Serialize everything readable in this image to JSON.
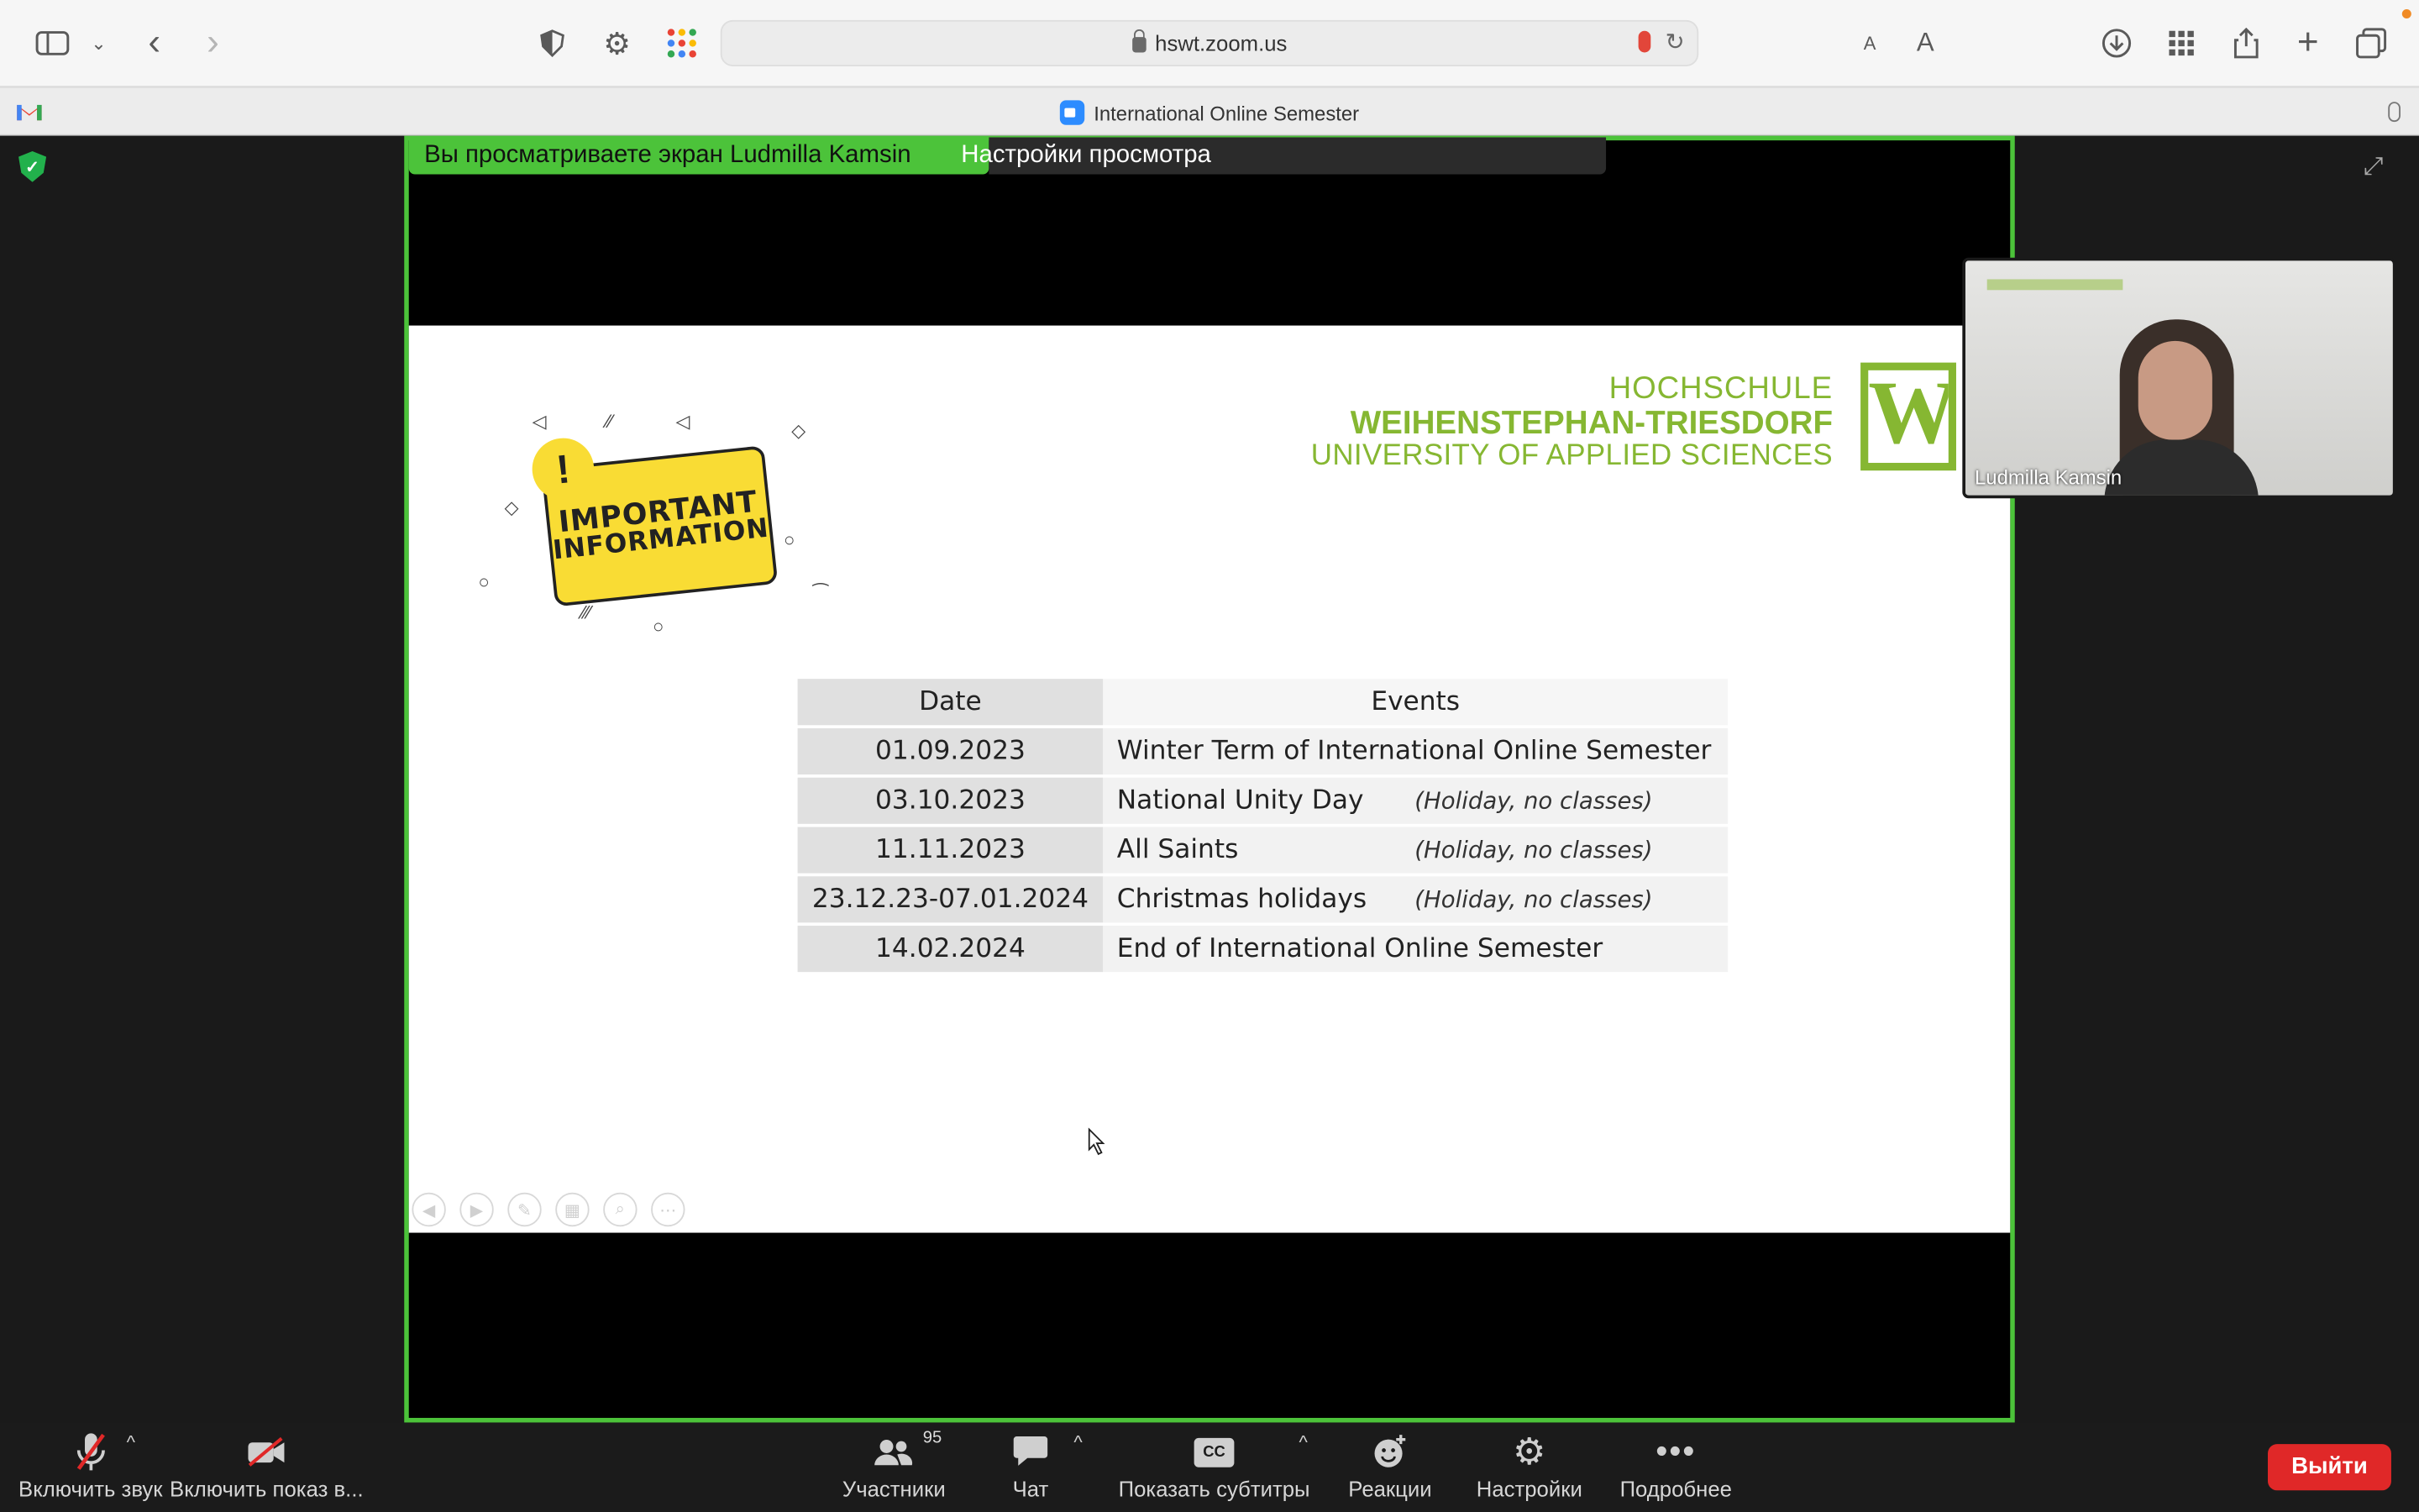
{
  "browser": {
    "url": "hswt.zoom.us",
    "text_size_small": "A",
    "text_size_large": "A"
  },
  "tab": {
    "title": "International Online Semester"
  },
  "share_banner": {
    "viewing_text": "Вы просматриваете экран Ludmilla Kamsin",
    "view_options": "Настройки просмотра"
  },
  "slide": {
    "badge_line1": "IMPORTANT",
    "badge_line2": "INFORMATION",
    "logo": {
      "line1": "HOCHSCHULE",
      "line2": "WEIHENSTEPHAN-TRIESDORF",
      "line3": "UNIVERSITY OF APPLIED SCIENCES",
      "mark": "W"
    },
    "table": {
      "headers": [
        "Date",
        "Events"
      ],
      "rows": [
        {
          "date": "01.09.2023",
          "event": "Winter Term of International Online Semester",
          "note": ""
        },
        {
          "date": "03.10.2023",
          "event": "National Unity Day",
          "note": "(Holiday, no classes)"
        },
        {
          "date": "11.11.2023",
          "event": "All Saints",
          "note": "(Holiday, no classes)"
        },
        {
          "date": "23.12.23-07.01.2024",
          "event": "Christmas  holidays",
          "note": "(Holiday, no classes)"
        },
        {
          "date": "14.02.2024",
          "event": "End of International Online Semester",
          "note": ""
        }
      ]
    }
  },
  "video": {
    "participant_name": "Ludmilla Kamsin"
  },
  "controls": {
    "unmute": "Включить звук",
    "start_video": "Включить показ в...",
    "participants": "Участники",
    "participants_count": "95",
    "chat": "Чат",
    "captions": "Показать субтитры",
    "captions_icon": "CC",
    "reactions": "Реакции",
    "settings": "Настройки",
    "more": "Подробнее",
    "leave": "Выйти"
  },
  "colors": {
    "share_green": "#4cc33a",
    "hswt_green": "#86b732",
    "leave_red": "#e02828",
    "badge_yellow": "#f9dc34"
  }
}
